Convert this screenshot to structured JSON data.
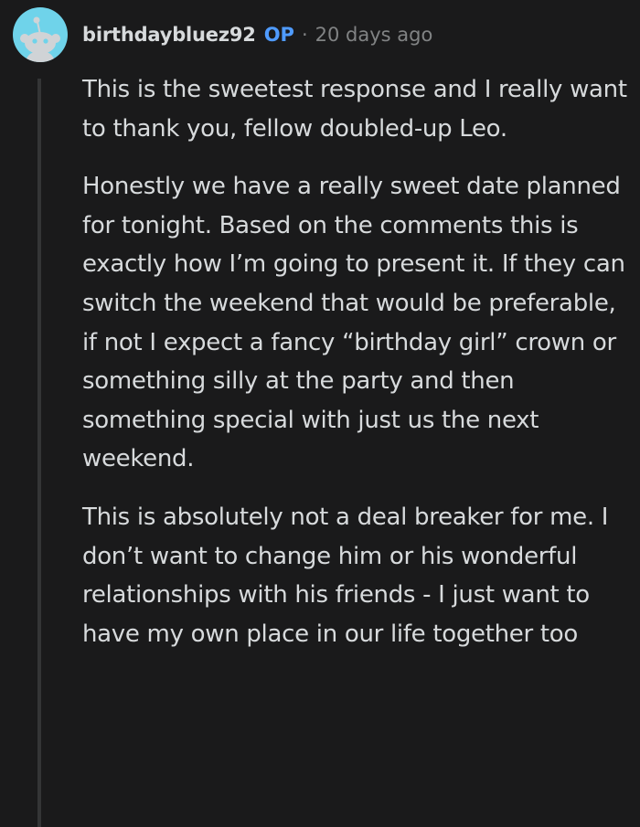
{
  "comment": {
    "username": "birthdaybluez92",
    "op_badge": "OP",
    "separator": "·",
    "timestamp": "20 days ago",
    "avatar_icon": "snoo-avatar-icon",
    "colors": {
      "background": "#1a1a1b",
      "text": "#d7dadc",
      "meta": "#818384",
      "op_badge": "#4f9bff",
      "avatar_bg": "#6fd3ea",
      "thread_line": "#343536"
    },
    "paragraphs": [
      "This is the sweetest response and I really want to thank you, fellow doubled-up Leo.",
      "Honestly we have a really sweet date planned for tonight. Based on the comments this is exactly how I’m going to present it. If they can switch the weekend that would be preferable, if not I expect a fancy “birthday girl” crown or something silly at the party and then something special with just us the next weekend.",
      "This is absolutely not a deal breaker for me. I don’t want to change him or his wonderful relationships with his friends - I just want to have my own place in our life together too"
    ]
  }
}
